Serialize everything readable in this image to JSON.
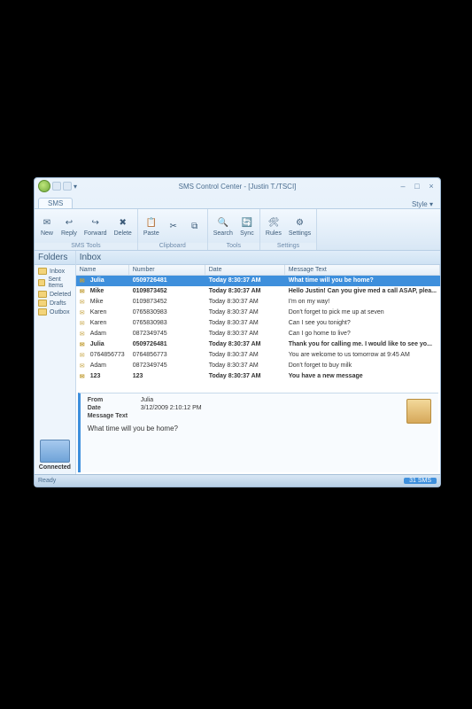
{
  "window": {
    "title": "SMS Control Center - [Justin T./TSCI]"
  },
  "qat": {
    "dropdown": "▾"
  },
  "tabs": {
    "main": "SMS",
    "style": "Style ▾"
  },
  "ribbon": {
    "new": "New",
    "reply": "Reply",
    "forward": "Forward",
    "delete": "Delete",
    "paste": "Paste",
    "search": "Search",
    "sync": "Sync",
    "rules": "Rules",
    "settings": "Settings",
    "group_sms": "SMS Tools",
    "group_clip": "Clipboard",
    "group_tools": "Tools",
    "group_settings": "Settings"
  },
  "folders": {
    "header": "Folders",
    "items": [
      {
        "label": "Inbox"
      },
      {
        "label": "Sent Items"
      },
      {
        "label": "Deleted"
      },
      {
        "label": "Drafts"
      },
      {
        "label": "Outbox"
      }
    ]
  },
  "connected": {
    "label": "Connected"
  },
  "inbox": {
    "header": "Inbox",
    "cols": {
      "name": "Name",
      "number": "Number",
      "date": "Date",
      "text": "Message Text"
    },
    "rows": [
      {
        "name": "Julia",
        "number": "0509726481",
        "date": "Today  8:30:37 AM",
        "text": "What time will you be home?",
        "selected": true,
        "unread": true
      },
      {
        "name": "Mike",
        "number": "0109873452",
        "date": "Today  8:30:37 AM",
        "text": "Hello Justin! Can you give med a call ASAP, plea...",
        "unread": true
      },
      {
        "name": "Mike",
        "number": "0109873452",
        "date": "Today  8:30:37 AM",
        "text": "I'm on my way!"
      },
      {
        "name": "Karen",
        "number": "0765830983",
        "date": "Today  8:30:37 AM",
        "text": "Don't forget to pick me up at seven"
      },
      {
        "name": "Karen",
        "number": "0765830983",
        "date": "Today  8:30:37 AM",
        "text": "Can I see you tonight?"
      },
      {
        "name": "Adam",
        "number": "0872349745",
        "date": "Today  8:30:37 AM",
        "text": "Can I go home to live?"
      },
      {
        "name": "Julia",
        "number": "0509726481",
        "date": "Today  8:30:37 AM",
        "text": "Thank you for calling me. I would like to see yo...",
        "unread": true
      },
      {
        "name": "0764856773",
        "number": "0764856773",
        "date": "Today  8:30:37 AM",
        "text": "You are welcome to us tomorrow at 9:45 AM"
      },
      {
        "name": "Adam",
        "number": "0872349745",
        "date": "Today  8:30:37 AM",
        "text": "Don't forget to buy milk"
      },
      {
        "name": "123",
        "number": "123",
        "date": "Today  8:30:37 AM",
        "text": "You have a new message",
        "unread": true
      }
    ]
  },
  "preview": {
    "from_label": "From",
    "from": "Julia",
    "date_label": "Date",
    "date": "3/12/2009 2:10:12 PM",
    "body_label": "Message Text",
    "body": "What time will you be home?"
  },
  "status": {
    "left": "Ready",
    "right": "31 SMS"
  }
}
